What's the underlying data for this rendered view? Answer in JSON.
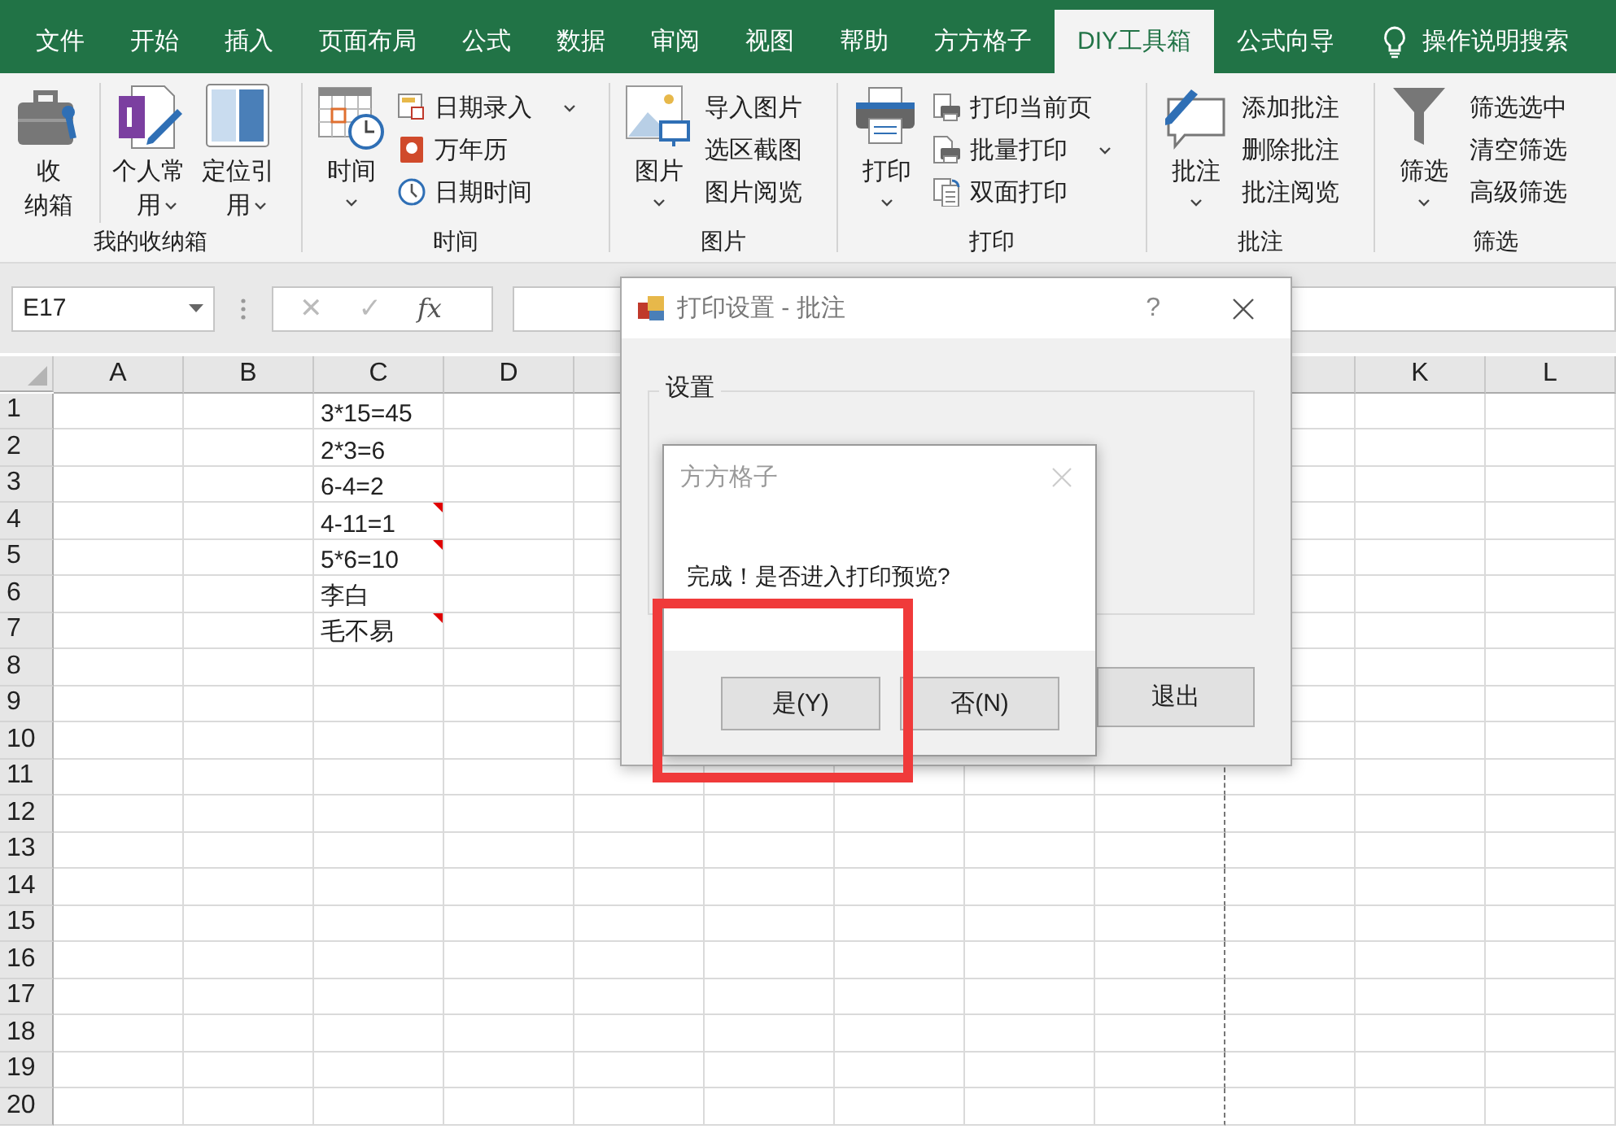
{
  "tabs": [
    {
      "label": "文件",
      "selected": false
    },
    {
      "label": "开始",
      "selected": false
    },
    {
      "label": "插入",
      "selected": false
    },
    {
      "label": "页面布局",
      "selected": false
    },
    {
      "label": "公式",
      "selected": false
    },
    {
      "label": "数据",
      "selected": false
    },
    {
      "label": "审阅",
      "selected": false
    },
    {
      "label": "视图",
      "selected": false
    },
    {
      "label": "帮助",
      "selected": false
    },
    {
      "label": "方方格子",
      "selected": false
    },
    {
      "label": "DIY工具箱",
      "selected": true
    },
    {
      "label": "公式向导",
      "selected": false
    }
  ],
  "tell_me": {
    "label": "操作说明搜索"
  },
  "ribbon_groups": [
    {
      "label": "我的收纳箱",
      "items": [
        {
          "kind": "large",
          "label": "收纳箱",
          "dropdown": false
        },
        {
          "kind": "large",
          "label": "个人常用",
          "dropdown": true
        },
        {
          "kind": "large",
          "label": "定位引用",
          "dropdown": true
        }
      ]
    },
    {
      "label": "时间",
      "items": [
        {
          "kind": "large",
          "label": "时间",
          "dropdown": true
        },
        {
          "kind": "small",
          "label": "日期录入",
          "dropdown": true
        },
        {
          "kind": "small",
          "label": "万年历",
          "dropdown": false
        },
        {
          "kind": "small",
          "label": "日期时间",
          "dropdown": false
        }
      ]
    },
    {
      "label": "图片",
      "items": [
        {
          "kind": "large",
          "label": "图片",
          "dropdown": true
        },
        {
          "kind": "small",
          "label": "导入图片",
          "dropdown": false
        },
        {
          "kind": "small",
          "label": "选区截图",
          "dropdown": false
        },
        {
          "kind": "small",
          "label": "图片阅览",
          "dropdown": false
        }
      ]
    },
    {
      "label": "打印",
      "items": [
        {
          "kind": "large",
          "label": "打印",
          "dropdown": true
        },
        {
          "kind": "small",
          "label": "打印当前页",
          "dropdown": false
        },
        {
          "kind": "small",
          "label": "批量打印",
          "dropdown": true
        },
        {
          "kind": "small",
          "label": "双面打印",
          "dropdown": false
        }
      ]
    },
    {
      "label": "批注",
      "items": [
        {
          "kind": "large",
          "label": "批注",
          "dropdown": true
        },
        {
          "kind": "small",
          "label": "添加批注",
          "dropdown": false
        },
        {
          "kind": "small",
          "label": "删除批注",
          "dropdown": false
        },
        {
          "kind": "small",
          "label": "批注阅览",
          "dropdown": false
        }
      ]
    },
    {
      "label": "筛选",
      "items": [
        {
          "kind": "large",
          "label": "筛选",
          "dropdown": true
        },
        {
          "kind": "small",
          "label": "筛选选中",
          "dropdown": false
        },
        {
          "kind": "small",
          "label": "清空筛选",
          "dropdown": false
        },
        {
          "kind": "small",
          "label": "高级筛选",
          "dropdown": false
        }
      ]
    }
  ],
  "formula_bar": {
    "name_box": "E17",
    "buttons": [
      {
        "label": "✕",
        "disabled": true
      },
      {
        "label": "✓",
        "disabled": true
      },
      {
        "label": "fx",
        "disabled": false
      }
    ]
  },
  "sheet": {
    "columns_left": [
      "A",
      "B",
      "C",
      "D"
    ],
    "columns_right": [
      "K",
      "L"
    ],
    "rows": [
      {
        "number": "1",
        "column_c": {
          "text": "3*15=45",
          "comment": false
        }
      },
      {
        "number": "2",
        "column_c": {
          "text": "2*3=6",
          "comment": false
        }
      },
      {
        "number": "3",
        "column_c": {
          "text": "6-4=2",
          "comment": false
        }
      },
      {
        "number": "4",
        "column_c": {
          "text": "4-11=1",
          "comment": true
        }
      },
      {
        "number": "5",
        "column_c": {
          "text": "5*6=10",
          "comment": true
        }
      },
      {
        "number": "6",
        "column_c": {
          "text": "李白",
          "comment": false
        }
      },
      {
        "number": "7",
        "column_c": {
          "text": "毛不易",
          "comment": true
        }
      },
      {
        "number": "8"
      },
      {
        "number": "9"
      },
      {
        "number": "10"
      },
      {
        "number": "11"
      },
      {
        "number": "12"
      },
      {
        "number": "13"
      },
      {
        "number": "14"
      },
      {
        "number": "15"
      },
      {
        "number": "16"
      },
      {
        "number": "17"
      },
      {
        "number": "18"
      },
      {
        "number": "19"
      },
      {
        "number": "20"
      }
    ]
  },
  "print_dialog": {
    "title": "打印设置 - 批注",
    "help": "?",
    "group_label": "设置",
    "exit_button": "退出"
  },
  "message_box": {
    "title": "方方格子",
    "message": "完成！是否进入打印预览?",
    "buttons": [
      {
        "label": "是(Y)",
        "highlighted": true
      },
      {
        "label": "否(N)",
        "highlighted": false
      }
    ]
  }
}
